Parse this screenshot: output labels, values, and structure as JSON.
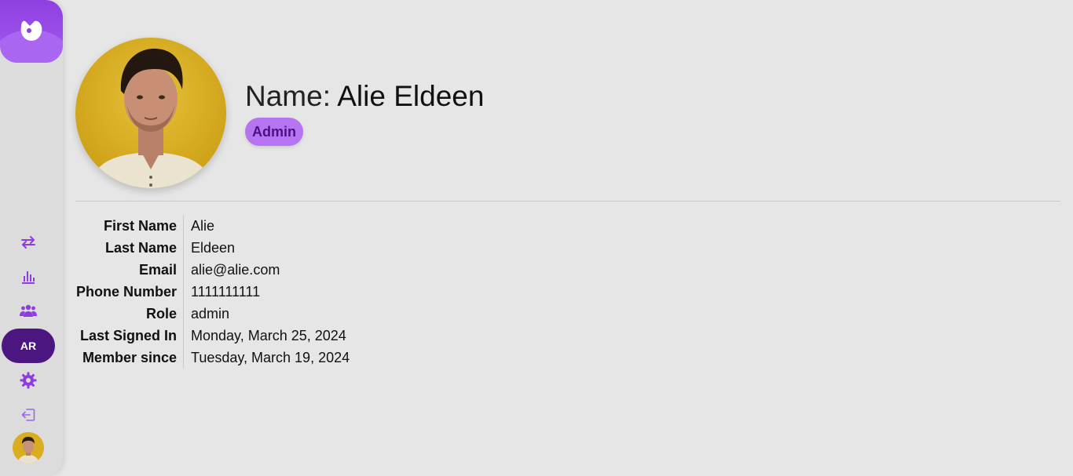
{
  "sidebar": {
    "logo_icon": "app-logo-icon",
    "items": [
      {
        "name": "transfer",
        "icon": "arrows-exchange-icon"
      },
      {
        "name": "analytics",
        "icon": "bar-chart-icon"
      },
      {
        "name": "users",
        "icon": "users-group-icon"
      }
    ],
    "language_label": "AR",
    "settings_icon": "gear-icon",
    "logout_icon": "logout-icon",
    "accent_color": "#8e3be0",
    "dark_accent": "#4b1680"
  },
  "profile": {
    "name_prefix": "Name:",
    "name_value": "Alie Eldeen",
    "role_badge": "Admin",
    "badge_color": "#b774f2"
  },
  "details": [
    {
      "label": "First Name",
      "value": "Alie"
    },
    {
      "label": "Last Name",
      "value": "Eldeen"
    },
    {
      "label": "Email",
      "value": "alie@alie.com"
    },
    {
      "label": "Phone Number",
      "value": "1111111111"
    },
    {
      "label": "Role",
      "value": "admin"
    },
    {
      "label": "Last Signed In",
      "value": "Monday, March 25, 2024"
    },
    {
      "label": "Member since",
      "value": "Tuesday, March 19, 2024"
    }
  ]
}
